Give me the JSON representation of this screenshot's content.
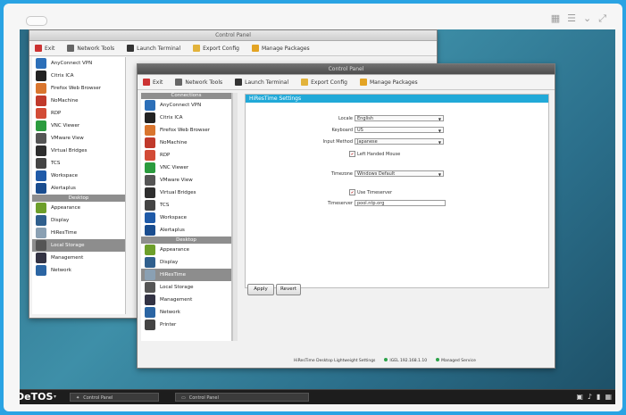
{
  "frame": {
    "icons": [
      "grid-icon",
      "list-icon",
      "chevron-down-icon",
      "expand-icon"
    ]
  },
  "back_window": {
    "title": "Control Panel",
    "toolbar": [
      "Exit",
      "Network Tools",
      "Launch Terminal",
      "Export Config",
      "Manage Packages"
    ],
    "nav": [
      {
        "label": "AnyConnect VPN",
        "color": "#2c6fb8"
      },
      {
        "label": "Citrix ICA",
        "color": "#222"
      },
      {
        "label": "Firefox Web Browser",
        "color": "#d9752e"
      },
      {
        "label": "NoMachine",
        "color": "#c0392b"
      },
      {
        "label": "RDP",
        "color": "#d24b36"
      },
      {
        "label": "VNC Viewer",
        "color": "#2b9b3e"
      },
      {
        "label": "VMware View",
        "color": "#555"
      },
      {
        "label": "Virtual Bridges",
        "color": "#2e2e2e"
      },
      {
        "label": "TCS",
        "color": "#444"
      },
      {
        "label": "Workspace",
        "color": "#1f5aa8"
      },
      {
        "label": "Alertaplus",
        "color": "#1a4d8f"
      }
    ],
    "section": "Desktop",
    "nav2": [
      {
        "label": "Appearance",
        "color": "#6d9f2a"
      },
      {
        "label": "Display",
        "color": "#2f5f8d"
      },
      {
        "label": "HiResTime",
        "color": "#8aa0b3"
      },
      {
        "label": "Local Storage",
        "color": "#555",
        "selected": true
      },
      {
        "label": "Management",
        "color": "#334"
      },
      {
        "label": "Network",
        "color": "#2b65a3"
      }
    ]
  },
  "front_window": {
    "title": "Control Panel",
    "toolbar": [
      "Exit",
      "Network Tools",
      "Launch Terminal",
      "Export Config",
      "Manage Packages"
    ],
    "nav_header": "Connections",
    "nav": [
      {
        "label": "AnyConnect VPN",
        "color": "#2c6fb8"
      },
      {
        "label": "Citrix ICA",
        "color": "#222"
      },
      {
        "label": "Firefox Web Browser",
        "color": "#d9752e"
      },
      {
        "label": "NoMachine",
        "color": "#c0392b"
      },
      {
        "label": "RDP",
        "color": "#d24b36"
      },
      {
        "label": "VNC Viewer",
        "color": "#2b9b3e"
      },
      {
        "label": "VMware View",
        "color": "#555"
      },
      {
        "label": "Virtual Bridges",
        "color": "#2e2e2e"
      },
      {
        "label": "TCS",
        "color": "#444"
      },
      {
        "label": "Workspace",
        "color": "#1f5aa8"
      },
      {
        "label": "Alertaplus",
        "color": "#1a4d8f"
      }
    ],
    "section": "Desktop",
    "nav2": [
      {
        "label": "Appearance",
        "color": "#6d9f2a"
      },
      {
        "label": "Display",
        "color": "#2f5f8d"
      },
      {
        "label": "HiResTime",
        "color": "#8aa0b3",
        "selected": true
      },
      {
        "label": "Local Storage",
        "color": "#555"
      },
      {
        "label": "Management",
        "color": "#334"
      },
      {
        "label": "Network",
        "color": "#2b65a3"
      },
      {
        "label": "Printer",
        "color": "#444"
      }
    ],
    "panel": {
      "title": "HiResTime Settings",
      "fields": [
        {
          "label": "Locale",
          "value": "English"
        },
        {
          "label": "Keyboard",
          "value": "US"
        },
        {
          "label": "Input Method",
          "value": "Japanese"
        }
      ],
      "checkbox1": "Left Handed Mouse",
      "field4": {
        "label": "Timezone",
        "value": "Windows Default"
      },
      "checkbox2": "Use Timeserver",
      "timeserver": {
        "label": "Timeserver",
        "value": "pool.ntp.org"
      }
    },
    "buttons": {
      "apply": "Apply",
      "revert": "Revert"
    },
    "status": [
      "HiResTime Desktop Lightweight Settings",
      "IGEL 192.168.1.10",
      "Managed Service"
    ]
  },
  "taskbar": {
    "logo": "DeTOS",
    "items": [
      "Control Panel",
      "Control Panel"
    ]
  }
}
